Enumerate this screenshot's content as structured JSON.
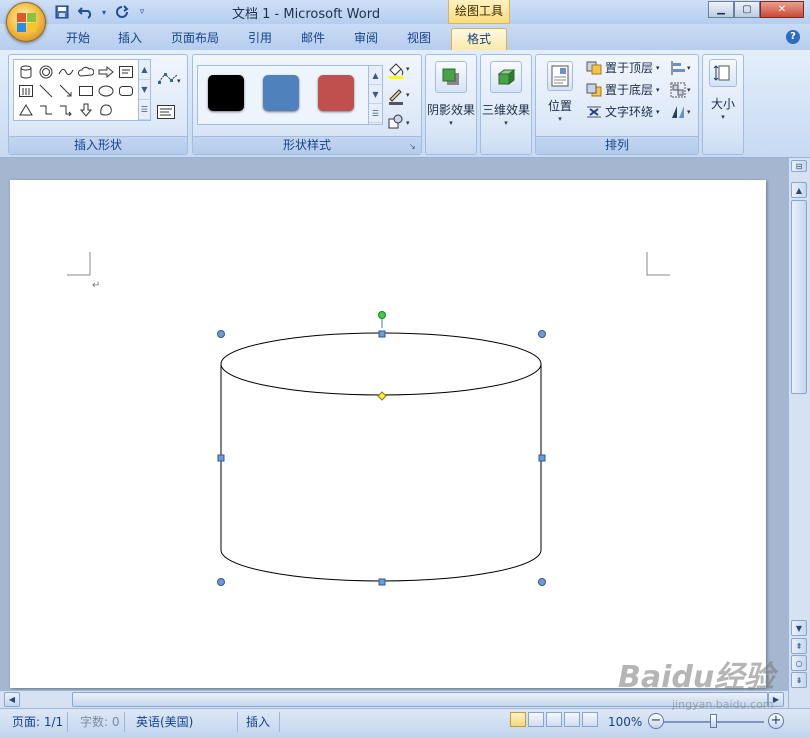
{
  "window": {
    "title": "文档 1 - Microsoft Word",
    "context_tab_label": "绘图工具",
    "controls": {
      "minimize": "▁",
      "maximize": "▢",
      "close": "✕"
    }
  },
  "quick_access": [
    "save-icon",
    "undo-icon",
    "redo-icon",
    "customize-icon"
  ],
  "tabs": [
    {
      "label": "开始",
      "active": false
    },
    {
      "label": "插入",
      "active": false
    },
    {
      "label": "页面布局",
      "active": false
    },
    {
      "label": "引用",
      "active": false
    },
    {
      "label": "邮件",
      "active": false
    },
    {
      "label": "审阅",
      "active": false
    },
    {
      "label": "视图",
      "active": false
    },
    {
      "label": "格式",
      "active": true
    }
  ],
  "ribbon": {
    "insert_shapes": {
      "label": "插入形状"
    },
    "shape_styles": {
      "label": "形状样式",
      "swatch_colors": [
        "#000000",
        "#4f81bd",
        "#c0504d"
      ]
    },
    "shadow_effects": {
      "label": "阴影效果"
    },
    "three_d_effects": {
      "label": "三维效果"
    },
    "arrange": {
      "label": "排列",
      "position": "位置",
      "bring_to_front": "置于顶层",
      "send_to_back": "置于底层",
      "text_wrapping": "文字环绕"
    },
    "size": {
      "label": "大小"
    }
  },
  "document": {
    "paragraph_mark": "↵",
    "shape": "cylinder"
  },
  "statusbar": {
    "page": "页面: 1/1",
    "word_count": "字数: 0",
    "language": "英语(美国)",
    "mode": "插入",
    "zoom": "100%"
  },
  "watermark": {
    "brand": "Baidu经验",
    "url": "jingyan.baidu.com"
  }
}
